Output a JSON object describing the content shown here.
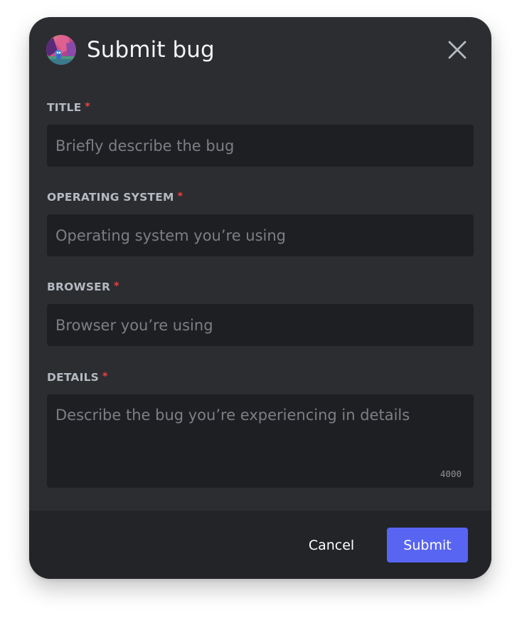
{
  "modal": {
    "title": "Submit bug",
    "avatar_icon": "avatar-illustration",
    "close_icon": "close-icon"
  },
  "form": {
    "title": {
      "label": "TITLE",
      "required_mark": "*",
      "value": "",
      "placeholder": "Briefly describe the bug"
    },
    "operating_system": {
      "label": "OPERATING SYSTEM",
      "required_mark": "*",
      "value": "",
      "placeholder": "Operating system you’re using"
    },
    "browser": {
      "label": "BROWSER",
      "required_mark": "*",
      "value": "",
      "placeholder": "Browser you’re using"
    },
    "details": {
      "label": "DETAILS",
      "required_mark": "*",
      "value": "",
      "placeholder": "Describe the bug you’re experiencing in details",
      "char_limit": "4000"
    }
  },
  "footer": {
    "cancel_label": "Cancel",
    "submit_label": "Submit"
  },
  "colors": {
    "modal_bg": "#2b2d31",
    "footer_bg": "#232428",
    "input_bg": "#1e1f22",
    "label_text": "#b5bac1",
    "required": "#f23f43",
    "primary_button": "#5865f2"
  }
}
